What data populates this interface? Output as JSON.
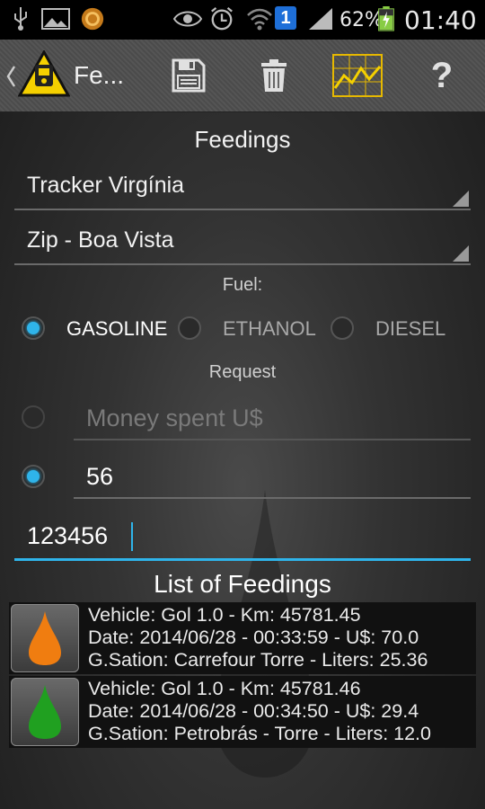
{
  "status_bar": {
    "battery": "62%",
    "time": "01:40",
    "sim_badge": "1",
    "icons": [
      "usb-icon",
      "image-icon",
      "sync-icon",
      "eye-icon",
      "alarm-icon",
      "wifi-icon",
      "sim-icon",
      "signal-icon",
      "battery-icon"
    ]
  },
  "action_bar": {
    "title": "Fe...",
    "icons": [
      "back-icon",
      "app-logo-icon",
      "save-icon",
      "trash-icon",
      "chart-icon",
      "help-icon"
    ],
    "help_glyph": "?"
  },
  "form": {
    "heading": "Feedings",
    "vehicle_spinner": "Tracker Virgínia",
    "station_spinner": "Zip - Boa Vista",
    "fuel_label": "Fuel:",
    "fuel_options": [
      {
        "label": "GASOLINE",
        "selected": true
      },
      {
        "label": "ETHANOL",
        "selected": false
      },
      {
        "label": "DIESEL",
        "selected": false
      }
    ],
    "request_label": "Request",
    "money_placeholder": "Money spent U$",
    "money_selected": false,
    "liters_value": "56",
    "liters_selected": true,
    "km_value": "123456"
  },
  "list": {
    "heading": "List of Feedings",
    "items": [
      {
        "drop_color": "#f07d10",
        "line1": "Vehicle: Gol 1.0 - Km: 45781.45",
        "line2": "Date: 2014/06/28 - 00:33:59 - U$: 70.0",
        "line3": "G.Sation: Carrefour Torre - Liters: 25.36"
      },
      {
        "drop_color": "#20a020",
        "line1": "Vehicle: Gol 1.0 - Km: 45781.46",
        "line2": "Date: 2014/06/28 - 00:34:50 - U$: 29.4",
        "line3": "G.Sation: Petrobrás - Torre - Liters: 12.0"
      }
    ]
  },
  "colors": {
    "accent": "#2fb4ea",
    "logo_yellow": "#f5d000"
  }
}
